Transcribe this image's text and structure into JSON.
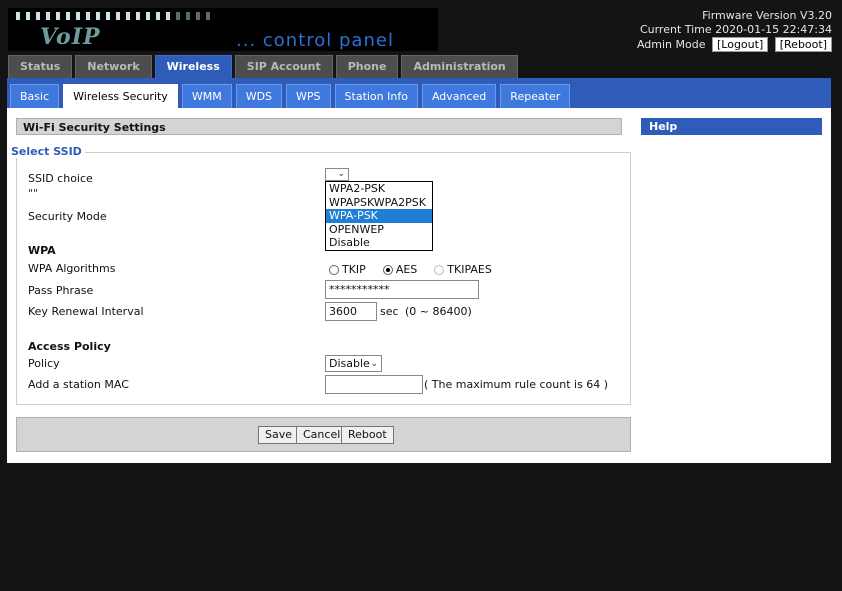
{
  "header": {
    "logo_voip": "VoIP",
    "logo_tagline": "... control panel",
    "firmware": "Firmware Version V3.20",
    "current_time": "Current Time 2020-01-15 22:47:34",
    "admin_mode": "Admin Mode",
    "logout_label": "[Logout]",
    "reboot_label": "[Reboot]"
  },
  "main_tabs": [
    {
      "label": "Status"
    },
    {
      "label": "Network"
    },
    {
      "label": "Wireless",
      "active": true
    },
    {
      "label": "SIP Account"
    },
    {
      "label": "Phone"
    },
    {
      "label": "Administration"
    }
  ],
  "sub_tabs": [
    {
      "label": "Basic"
    },
    {
      "label": "Wireless Security",
      "active": true
    },
    {
      "label": "WMM"
    },
    {
      "label": "WDS"
    },
    {
      "label": "WPS"
    },
    {
      "label": "Station Info"
    },
    {
      "label": "Advanced"
    },
    {
      "label": "Repeater"
    }
  ],
  "section_title": "Wi-Fi Security Settings",
  "help_title": "Help",
  "select_ssid": {
    "legend": "Select SSID",
    "ssid_choice_label": "SSID choice",
    "ssid_choice_value": "",
    "ssid_name": "\"\"",
    "security_mode_label": "Security Mode",
    "security_mode_options": [
      "WPA2-PSK",
      "WPAPSKWPA2PSK",
      "WPA-PSK",
      "OPENWEP",
      "Disable"
    ],
    "security_mode_highlighted": "WPA-PSK"
  },
  "wpa": {
    "heading": "WPA",
    "algorithms_label": "WPA Algorithms",
    "algo_tkip": "TKIP",
    "algo_aes": "AES",
    "algo_tkipaes": "TKIPAES",
    "algo_selected": "AES",
    "pass_phrase_label": "Pass Phrase",
    "pass_phrase_value": "***********",
    "key_renewal_label": "Key Renewal Interval",
    "key_renewal_value": "3600",
    "key_renewal_unit": "sec",
    "key_renewal_range": "(0 ~ 86400)"
  },
  "access_policy": {
    "heading": "Access Policy",
    "policy_label": "Policy",
    "policy_value": "Disable",
    "add_mac_label": "Add a station MAC",
    "add_mac_value": "",
    "max_rule_note": "( The maximum rule count is 64 )"
  },
  "buttons": {
    "save": "Save",
    "cancel": "Cancel",
    "reboot": "Reboot"
  },
  "colors": {
    "accent_blue": "#2e5cb8",
    "highlight_blue": "#1f7fd6",
    "page_bg": "#141414"
  }
}
